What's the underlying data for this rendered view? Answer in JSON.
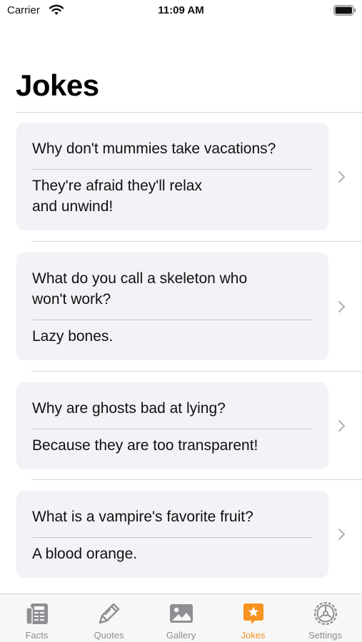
{
  "status_bar": {
    "carrier": "Carrier",
    "time": "11:09 AM"
  },
  "page": {
    "title": "Jokes"
  },
  "jokes": [
    {
      "question": "Why don't mummies take vacations?",
      "answer": "They're afraid they'll relax\nand unwind!"
    },
    {
      "question": "What do you call a skeleton who\nwon't work?",
      "answer": "Lazy bones."
    },
    {
      "question": "Why are ghosts bad at lying?",
      "answer": "Because they are too transparent!"
    },
    {
      "question": "What is a vampire's favorite fruit?",
      "answer": "A blood orange."
    }
  ],
  "tab_bar": {
    "tabs": [
      {
        "label": "Facts",
        "icon": "facts-icon"
      },
      {
        "label": "Quotes",
        "icon": "quotes-icon"
      },
      {
        "label": "Gallery",
        "icon": "gallery-icon"
      },
      {
        "label": "Jokes",
        "icon": "jokes-icon",
        "active": true
      },
      {
        "label": "Settings",
        "icon": "settings-icon"
      }
    ],
    "active_color": "#f7931e",
    "inactive_color": "#8e8e93"
  },
  "colors": {
    "card_background": "#f2f2f7",
    "divider": "#d6d6d9"
  }
}
